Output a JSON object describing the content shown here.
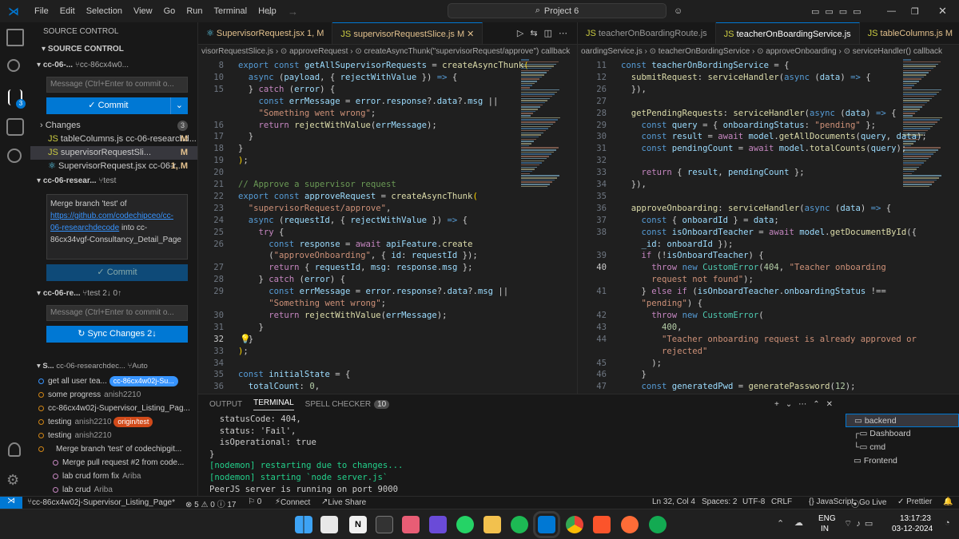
{
  "titlebar": {
    "menu": [
      "File",
      "Edit",
      "Selection",
      "View",
      "Go",
      "Run",
      "Terminal",
      "Help"
    ],
    "search": "Project 6"
  },
  "sidebar": {
    "title": "SOURCE CONTROL",
    "section_title": "SOURCE CONTROL",
    "repo1": {
      "name": "cc-06-...",
      "branch": "cc-86cx4w0...",
      "input_placeholder": "Message (Ctrl+Enter to commit o...",
      "commit_label": "Commit",
      "changes_label": "Changes",
      "changes_count": "3",
      "files": [
        {
          "name": "tableColumns.js  cc-06-researchd...",
          "status": "M"
        },
        {
          "name": "supervisorRequestSli...",
          "status": "M"
        },
        {
          "name": "SupervisorRequest.jsx  cc-06-r...",
          "status": "1, M"
        }
      ]
    },
    "repo2": {
      "name": "cc-06-resear...",
      "branch": "test",
      "commit_message_pre": "Merge branch 'test' of ",
      "commit_message_link": "https://github.com/codechipceo/cc-06-researchdecode",
      "commit_message_post": " into cc-86cx34vgf-Consultancy_Detail_Page",
      "commit_label": "Commit"
    },
    "repo3": {
      "name": "cc-06-re...",
      "branch": "test",
      "sync": "2↓ 0↑",
      "input_placeholder": "Message (Ctrl+Enter to commit o...",
      "sync_label": "Sync Changes 2↓"
    },
    "graph_header": {
      "name": "S...",
      "repo": "cc-06-researchdec...",
      "mode": "Auto"
    },
    "graph": [
      {
        "msg": "get all user tea...",
        "author": "",
        "badge": "cc-86cx4w02j-Su..."
      },
      {
        "msg": "some progress",
        "author": "anish2210",
        "badge": ""
      },
      {
        "msg": "cc-86cx4w02j-Supervisor_Listing_Pag...",
        "author": "",
        "badge": ""
      },
      {
        "msg": "testing",
        "author": "anish2210",
        "badge": "origin/test"
      },
      {
        "msg": "testing",
        "author": "anish2210",
        "badge": ""
      },
      {
        "msg": "Merge branch 'test' of codechipgit...",
        "author": "",
        "badge": ""
      },
      {
        "msg": "Merge pull request #2 from code...",
        "author": "",
        "badge": ""
      },
      {
        "msg": "lab crud form fix",
        "author": "Ariba",
        "badge": ""
      },
      {
        "msg": "lab crud",
        "author": "Ariba",
        "badge": ""
      }
    ]
  },
  "editor1": {
    "tabs": [
      {
        "label": "SupervisorRequest.jsx  1, M",
        "state": "modified"
      },
      {
        "label": "supervisorRequestSlice.js  M",
        "state": "active"
      }
    ],
    "breadcrumbs": "visorRequestSlice.js  ›  ⊙ approveRequest  ›  ⊙ createAsyncThunk(\"supervisorRequest/approve\") callback",
    "lines": [
      {
        "n": "8",
        "html": "<span class='kw'>export const</span> <span class='var'>getAllSupervisorRequests</span> = <span class='fn'>createAsyncThunk</span><span class='br'>(</span>"
      },
      {
        "n": "10",
        "html": "  <span class='kw'>async</span> (<span class='var'>payload</span>, { <span class='var'>rejectWithValue</span> }) <span class='kw'>=&gt;</span> {"
      },
      {
        "n": "15",
        "html": "  } <span class='ctl'>catch</span> (<span class='var'>error</span>) {"
      },
      {
        "n": "",
        "html": "    <span class='kw'>const</span> <span class='var'>errMessage</span> = <span class='var'>error</span>.<span class='var'>response</span>?.<span class='var'>data</span>?.<span class='var'>msg</span> ||"
      },
      {
        "n": "",
        "html": "    <span class='str'>\"Something went wrong\"</span>;"
      },
      {
        "n": "16",
        "html": "    <span class='ctl'>return</span> <span class='fn'>rejectWithValue</span>(<span class='var'>errMessage</span>);"
      },
      {
        "n": "17",
        "html": "  }"
      },
      {
        "n": "18",
        "html": "}"
      },
      {
        "n": "19",
        "html": "<span class='br'>)</span>;"
      },
      {
        "n": "20",
        "html": ""
      },
      {
        "n": "21",
        "html": "<span class='cm'>// Approve a supervisor request</span>"
      },
      {
        "n": "22",
        "html": "<span class='kw'>export const</span> <span class='var'>approveRequest</span> = <span class='fn'>createAsyncThunk</span><span class='br'>(</span>"
      },
      {
        "n": "23",
        "html": "  <span class='str'>\"supervisorRequest/approve\"</span>,"
      },
      {
        "n": "24",
        "html": "  <span class='kw'>async</span> (<span class='var'>requestId</span>, { <span class='var'>rejectWithValue</span> }) <span class='kw'>=&gt;</span> {"
      },
      {
        "n": "25",
        "html": "    <span class='ctl'>try</span> {"
      },
      {
        "n": "26",
        "html": "      <span class='kw'>const</span> <span class='var'>response</span> = <span class='ctl'>await</span> <span class='var'>apiFeature</span>.<span class='fn'>create</span>"
      },
      {
        "n": "",
        "html": "      (<span class='str'>\"approveOnboarding\"</span>, { <span class='var'>id</span>: <span class='var'>requestId</span> });"
      },
      {
        "n": "27",
        "html": "      <span class='ctl'>return</span> { <span class='var'>requestId</span>, <span class='var'>msg</span>: <span class='var'>response</span>.<span class='var'>msg</span> };"
      },
      {
        "n": "28",
        "html": "    } <span class='ctl'>catch</span> (<span class='var'>error</span>) {"
      },
      {
        "n": "29",
        "html": "      <span class='kw'>const</span> <span class='var'>errMessage</span> = <span class='var'>error</span>.<span class='var'>response</span>?.<span class='var'>data</span>?.<span class='var'>msg</span> ||"
      },
      {
        "n": "",
        "html": "      <span class='str'>\"Something went wrong\"</span>;"
      },
      {
        "n": "30",
        "html": "      <span class='ctl'>return</span> <span class='fn'>rejectWithValue</span>(<span class='var'>errMessage</span>);"
      },
      {
        "n": "31",
        "html": "    }"
      },
      {
        "n": "32",
        "html": "  }"
      },
      {
        "n": "33",
        "html": "<span class='br'>)</span>;"
      },
      {
        "n": "34",
        "html": ""
      },
      {
        "n": "35",
        "html": "<span class='kw'>const</span> <span class='var'>initialState</span> = {"
      },
      {
        "n": "36",
        "html": "  <span class='var'>totalCount</span>: <span class='num'>0</span>,"
      }
    ]
  },
  "editor2": {
    "tabs": [
      {
        "label": "teacherOnBoardingRoute.js",
        "state": "normal"
      },
      {
        "label": "teacherOnBoardingService.js",
        "state": "active"
      },
      {
        "label": "tableColumns.js  M",
        "state": "modified"
      }
    ],
    "breadcrumbs": "oardingService.js  ›  ⊙ teacherOnBordingService  ›  ⊙ approveOnboarding  ›  ⊙ serviceHandler() callback",
    "lines": [
      {
        "n": "11",
        "html": "<span class='kw'>const</span> <span class='var'>teacherOnBordingService</span> = {"
      },
      {
        "n": "12",
        "html": "  <span class='fn'>submitRequest</span>: <span class='fn'>serviceHandler</span>(<span class='kw'>async</span> (<span class='var'>data</span>) <span class='kw'>=&gt;</span> {"
      },
      {
        "n": "26",
        "html": "  }),"
      },
      {
        "n": "27",
        "html": ""
      },
      {
        "n": "28",
        "html": "  <span class='fn'>getPendingRequests</span>: <span class='fn'>serviceHandler</span>(<span class='kw'>async</span> (<span class='var'>data</span>) <span class='kw'>=&gt;</span> {"
      },
      {
        "n": "29",
        "html": "    <span class='kw'>const</span> <span class='var'>query</span> = { <span class='var'>onboardingStatus</span>: <span class='str'>\"pending\"</span> };"
      },
      {
        "n": "30",
        "html": "    <span class='kw'>const</span> <span class='var'>result</span> = <span class='ctl'>await</span> <span class='var'>model</span>.<span class='fn'>getAllDocuments</span>(<span class='var'>query</span>, <span class='var'>data</span>);"
      },
      {
        "n": "31",
        "html": "    <span class='kw'>const</span> <span class='var'>pendingCount</span> = <span class='ctl'>await</span> <span class='var'>model</span>.<span class='fn'>totalCounts</span>(<span class='var'>query</span>);"
      },
      {
        "n": "32",
        "html": ""
      },
      {
        "n": "33",
        "html": "    <span class='ctl'>return</span> { <span class='var'>result</span>, <span class='var'>pendingCount</span> };"
      },
      {
        "n": "34",
        "html": "  }),"
      },
      {
        "n": "35",
        "html": ""
      },
      {
        "n": "36",
        "html": "  <span class='fn'>approveOnboarding</span>: <span class='fn'>serviceHandler</span>(<span class='kw'>async</span> (<span class='var'>data</span>) <span class='kw'>=&gt;</span> {"
      },
      {
        "n": "37",
        "html": "    <span class='kw'>const</span> { <span class='var'>onboardId</span> } = <span class='var'>data</span>;"
      },
      {
        "n": "38",
        "html": "    <span class='kw'>const</span> <span class='var'>isOnboardTeacher</span> = <span class='ctl'>await</span> <span class='var'>model</span>.<span class='fn'>getDocumentById</span>({"
      },
      {
        "n": "",
        "html": "    <span class='var'>_id</span>: <span class='var'>onboardId</span> });"
      },
      {
        "n": "39",
        "html": "    <span class='ctl'>if</span> (!<span class='var'>isOnboardTeacher</span>) {"
      },
      {
        "n": "40",
        "html": "      <span class='ctl'>throw</span> <span class='kw'>new</span> <span class='cls'>CustomError</span>(<span class='num'>404</span>, <span class='str'>\"Teacher onboarding</span>"
      },
      {
        "n": "",
        "html": "      <span class='str'>request not found\"</span>);"
      },
      {
        "n": "41",
        "html": "    } <span class='ctl'>else if</span> (<span class='var'>isOnboardTeacher</span>.<span class='var'>onboardingStatus</span> !=="
      },
      {
        "n": "",
        "html": "    <span class='str'>\"pending\"</span>) {"
      },
      {
        "n": "42",
        "html": "      <span class='ctl'>throw</span> <span class='kw'>new</span> <span class='cls'>CustomError</span>("
      },
      {
        "n": "43",
        "html": "        <span class='num'>400</span>,"
      },
      {
        "n": "44",
        "html": "        <span class='str'>\"Teacher onboarding request is already approved or</span>"
      },
      {
        "n": "",
        "html": "        <span class='str'>rejected\"</span>"
      },
      {
        "n": "45",
        "html": "      );"
      },
      {
        "n": "46",
        "html": "    }"
      },
      {
        "n": "47",
        "html": "    <span class='kw'>const</span> <span class='var'>generatedPwd</span> = <span class='fn'>generatePassword</span>(<span class='num'>12</span>);"
      }
    ]
  },
  "panel": {
    "tabs": [
      "OUTPUT",
      "TERMINAL",
      "SPELL CHECKER"
    ],
    "spell_count": "10",
    "terminal_lines": [
      "  statusCode: 404,",
      "  status: 'Fail',",
      "  isOperational: true",
      "}",
      "[nodemon] restarting due to changes...",
      "[nodemon] starting `node server.js`",
      "PeerJS server is running on port 9000"
    ],
    "terminals": [
      "backend",
      "Dashboard",
      "cmd",
      "Frontend"
    ]
  },
  "statusbar": {
    "branch": "cc-86cx4w02j-Supervisor_Listing_Page*",
    "problems": "⊗ 5 ⚠ 0 ⓘ 17",
    "ports": "⚐ 0",
    "connect": "Connect",
    "liveshare": "Live Share",
    "position": "Ln 32, Col 4",
    "spaces": "Spaces: 2",
    "encoding": "UTF-8",
    "eol": "CRLF",
    "lang": "{} JavaScript",
    "golive": "Go Live",
    "prettier": "✓ Prettier"
  },
  "taskbar": {
    "lang1": "ENG",
    "lang2": "IN",
    "time": "13:17:23",
    "date": "03-12-2024"
  }
}
